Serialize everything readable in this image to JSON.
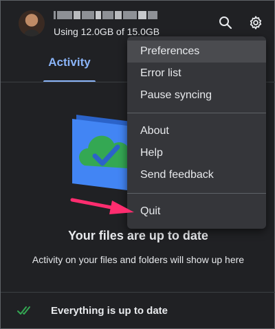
{
  "header": {
    "storage_text": "Using 12.0GB of 15.0GB",
    "search_icon": "search-icon",
    "settings_icon": "gear-icon"
  },
  "tabs": [
    {
      "label": "Activity",
      "selected": true
    }
  ],
  "empty_state": {
    "title": "Your files are up to date",
    "subtitle": "Activity on your files and folders will show up here"
  },
  "footer": {
    "status_text": "Everything is up to date",
    "icon": "double-check-icon"
  },
  "menu": {
    "groups": [
      [
        "Preferences",
        "Error list",
        "Pause syncing"
      ],
      [
        "About",
        "Help",
        "Send feedback"
      ],
      [
        "Quit"
      ]
    ]
  },
  "colors": {
    "background": "#202124",
    "menu_background": "#35363a",
    "accent": "#8ab4f8",
    "annotation_arrow": "#ff2d6f",
    "success": "#34a853"
  }
}
